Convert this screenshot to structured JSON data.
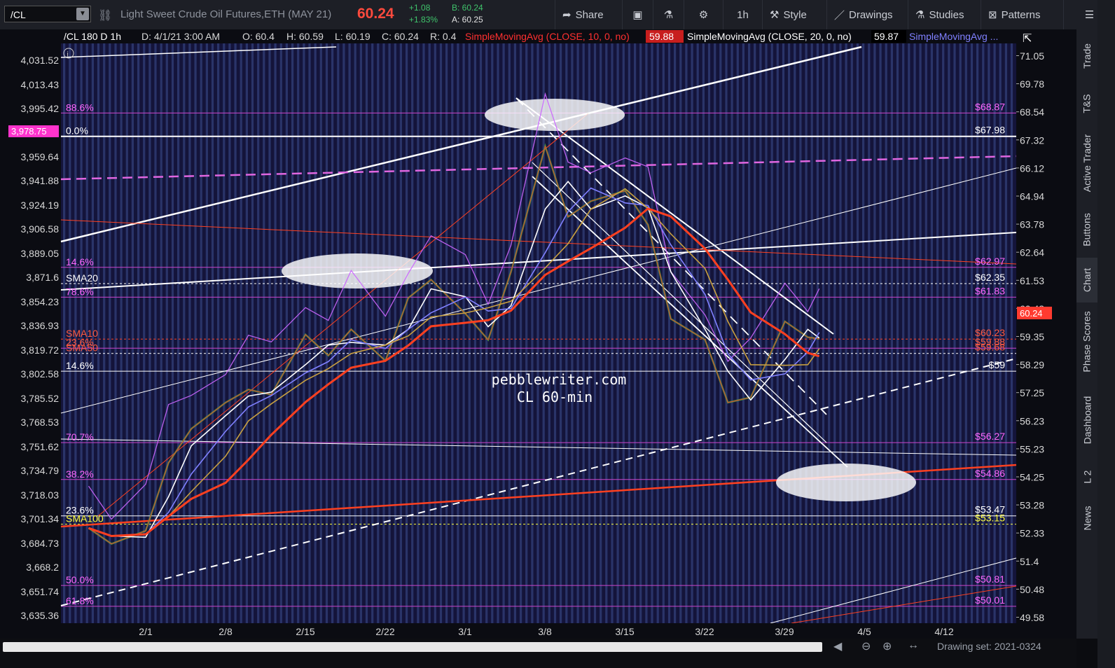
{
  "toolbar": {
    "symbol": "/CL",
    "description": "Light Sweet Crude Oil Futures,ETH (MAY 21)",
    "last": "60.24",
    "change": "+1.08",
    "change_pct": "+1.83%",
    "bid": "B: 60.24",
    "ask": "A: 60.25",
    "share": "Share",
    "interval": "1h",
    "style": "Style",
    "drawings": "Drawings",
    "studies": "Studies",
    "patterns": "Patterns"
  },
  "chart_header": {
    "title": "/CL 180 D 1h",
    "date": "D: 4/1/21 3:00 AM",
    "open": "O: 60.4",
    "high": "H: 60.59",
    "low": "L: 60.19",
    "close": "C: 60.24",
    "range": "R: 0.4",
    "sma10": "SimpleMovingAvg (CLOSE, 10, 0, no)",
    "sma10_val": "59.88",
    "sma20": "SimpleMovingAvg (CLOSE, 20, 0, no)",
    "sma20_val": "59.87",
    "sma_more": "SimpleMovingAvg ..."
  },
  "sidebar": [
    "Trade",
    "T&S",
    "Active Trader",
    "Buttons",
    "Chart",
    "Phase Scores",
    "Dashboard",
    "L 2",
    "News"
  ],
  "bottom": {
    "drawing_set": "Drawing set: 2021-0324"
  },
  "watermark": [
    "pebblewriter.com",
    "CL 60-min"
  ],
  "colors": {
    "background": "#14143a",
    "stripe": "#2e3a72",
    "sma10": "#ffffff",
    "sma20": "#8080ff",
    "sma50": "#c8a040",
    "sma100": "#ff4020",
    "spx": "#cc66ff",
    "fib": "#cc44cc",
    "price_tag": "#ff3b30"
  },
  "chart_data": {
    "type": "line",
    "x_ticks": [
      "2/1",
      "2/8",
      "2/15",
      "2/22",
      "3/1",
      "3/8",
      "3/15",
      "3/22",
      "3/29",
      "4/5",
      "4/12"
    ],
    "right_axis": [
      "71.05",
      "69.78",
      "68.54",
      "67.32",
      "66.12",
      "64.94",
      "63.78",
      "62.64",
      "61.53",
      "60.43",
      "59.35",
      "58.29",
      "57.25",
      "56.23",
      "55.23",
      "54.25",
      "53.28",
      "52.33",
      "51.4",
      "50.48",
      "49.58"
    ],
    "left_axis": [
      "4,031.52",
      "4,013.43",
      "3,995.42",
      "3,959.64",
      "3,941.88",
      "3,924.19",
      "3,906.58",
      "3,889.05",
      "3,871.6",
      "3,854.23",
      "3,836.93",
      "3,819.72",
      "3,802.58",
      "3,785.52",
      "3,768.53",
      "3,751.62",
      "3,734.79",
      "3,718.03",
      "3,701.34",
      "3,684.73",
      "3,668.2",
      "3,651.74",
      "3,635.36"
    ],
    "left_tag": "3,978.75",
    "last_price_tag": "60.24",
    "fib_levels": [
      {
        "left": "88.6%",
        "right": "$68.87",
        "price": 68.87
      },
      {
        "left": "0.0%",
        "right": "$67.98",
        "price": 67.98
      },
      {
        "left": "14.6%",
        "right": "$62.97",
        "price": 62.97
      },
      {
        "left": "SMA20",
        "right": "$62.35",
        "price": 62.35
      },
      {
        "left": "78.6%",
        "right": "$61.83",
        "price": 61.83
      },
      {
        "left": "SMA10",
        "right": "$60.23",
        "price": 60.23
      },
      {
        "left": "23.6%",
        "right": "$59.88",
        "price": 59.88
      },
      {
        "left": "SMA50",
        "right": "$59.68",
        "price": 59.68
      },
      {
        "left": "14.6%",
        "right": "$59",
        "price": 59.0
      },
      {
        "left": "70.7%",
        "right": "$56.27",
        "price": 56.27
      },
      {
        "left": "38.2%",
        "right": "$54.86",
        "price": 54.86
      },
      {
        "left": "23.6%",
        "right": "$53.47",
        "price": 53.47
      },
      {
        "left": "SMA100",
        "right": "$53.15",
        "price": 53.15
      },
      {
        "left": "50.0%",
        "right": "$50.81",
        "price": 50.81
      },
      {
        "left": "61.8%",
        "right": "$50.01",
        "price": 50.01
      }
    ],
    "price_path": [
      [
        "1/27",
        53.0
      ],
      [
        "1/29",
        52.4
      ],
      [
        "2/1",
        52.9
      ],
      [
        "2/3",
        55.5
      ],
      [
        "2/5",
        56.8
      ],
      [
        "2/8",
        57.8
      ],
      [
        "2/10",
        58.3
      ],
      [
        "2/12",
        58.1
      ],
      [
        "2/15",
        60.4
      ],
      [
        "2/17",
        59.6
      ],
      [
        "2/19",
        60.6
      ],
      [
        "2/22",
        59.4
      ],
      [
        "2/24",
        61.8
      ],
      [
        "2/26",
        62.5
      ],
      [
        "3/1",
        61.2
      ],
      [
        "3/3",
        60.2
      ],
      [
        "3/5",
        62.8
      ],
      [
        "3/8",
        67.6
      ],
      [
        "3/10",
        64.9
      ],
      [
        "3/12",
        65.5
      ],
      [
        "3/15",
        65.9
      ],
      [
        "3/17",
        64.6
      ],
      [
        "3/19",
        61.0
      ],
      [
        "3/22",
        60.2
      ],
      [
        "3/24",
        57.8
      ],
      [
        "3/26",
        58.0
      ],
      [
        "3/29",
        60.9
      ],
      [
        "3/31",
        60.3
      ],
      [
        "4/1",
        60.24
      ]
    ],
    "series": [
      {
        "name": "SMA10",
        "color": "#ffffff"
      },
      {
        "name": "SMA20",
        "color": "#8080ff"
      },
      {
        "name": "SMA50",
        "color": "#c8a040"
      },
      {
        "name": "SMA100",
        "color": "#ff4020"
      }
    ]
  }
}
